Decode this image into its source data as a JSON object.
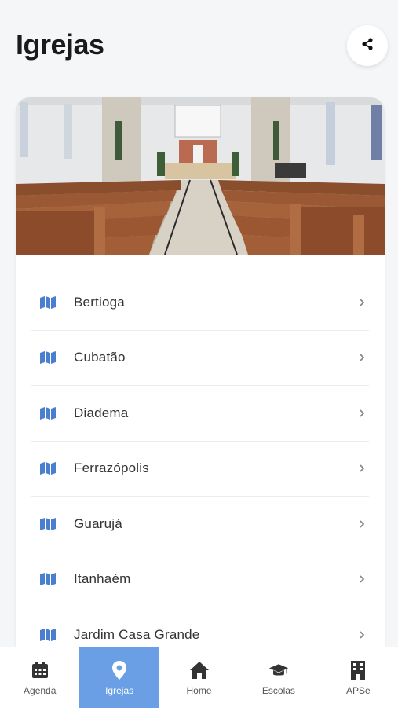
{
  "header": {
    "title": "Igrejas"
  },
  "hero": {
    "icon": "church-interior-photo"
  },
  "churches": [
    {
      "label": "Bertioga"
    },
    {
      "label": "Cubatão"
    },
    {
      "label": "Diadema"
    },
    {
      "label": "Ferrazópolis"
    },
    {
      "label": "Guarujá"
    },
    {
      "label": "Itanhaém"
    },
    {
      "label": "Jardim Casa Grande"
    }
  ],
  "tabs": [
    {
      "label": "Agenda",
      "icon": "calendar-icon"
    },
    {
      "label": "Igrejas",
      "icon": "map-pin-icon",
      "active": true
    },
    {
      "label": "Home",
      "icon": "home-icon"
    },
    {
      "label": "Escolas",
      "icon": "graduation-cap-icon"
    },
    {
      "label": "APSe",
      "icon": "building-icon"
    }
  ],
  "colors": {
    "accent": "#6a9fe6",
    "map_icon": "#4a7fd0"
  }
}
